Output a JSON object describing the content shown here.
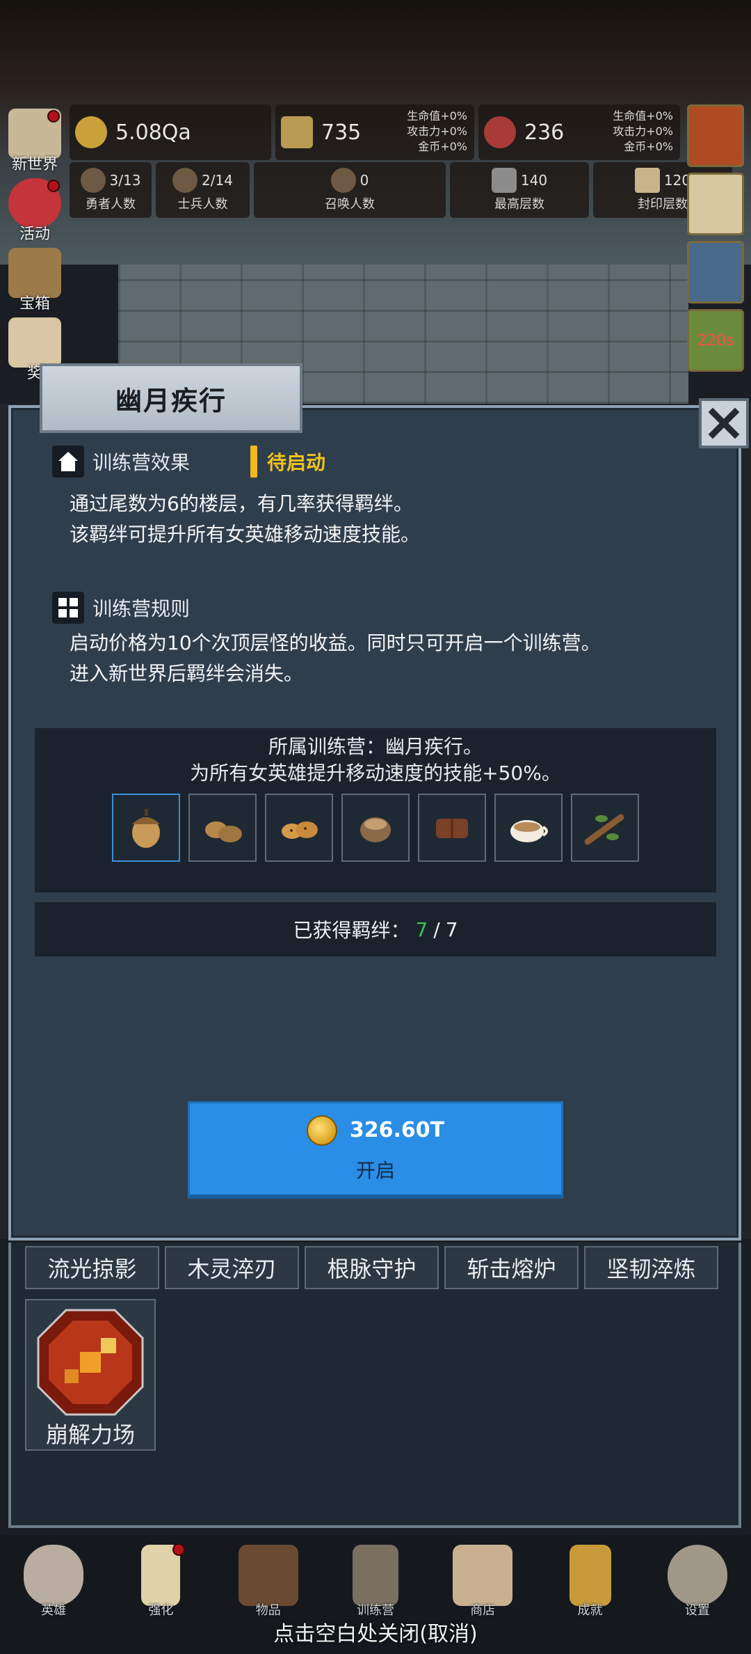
{
  "resources": {
    "gold": "5.08Qa",
    "wood": "735",
    "meat": "236",
    "bonus_a": [
      "生命值+0%",
      "攻击力+0%",
      "金币+0%"
    ],
    "bonus_b": [
      "生命值+0%",
      "攻击力+0%",
      "金币+0%"
    ]
  },
  "stats": [
    {
      "value": "3/13",
      "label": "勇者人数"
    },
    {
      "value": "2/14",
      "label": "士兵人数"
    },
    {
      "value": "0",
      "label": "召唤人数"
    },
    {
      "value": "140",
      "label": "最高层数"
    },
    {
      "value": "120",
      "label": "封印层数"
    }
  ],
  "side_nav": [
    "新世界",
    "活动",
    "宝箱",
    "奖"
  ],
  "right_timer": "220s",
  "modal": {
    "title": "幽月疾行",
    "effect_heading": "训练营效果",
    "status": "待启动",
    "effect_lines": [
      "通过尾数为6的楼层，有几率获得羁绊。",
      "该羁绊可提升所有女英雄移动速度技能。"
    ],
    "rules_heading": "训练营规则",
    "rules_lines": [
      "启动价格为10个次顶层怪的收益。同时只可开启一个训练营。",
      "进入新世界后羁绊会消失。"
    ],
    "bond_title_1": "所属训练营：幽月疾行。",
    "bond_title_2": "为所有女英雄提升移动速度的技能+50%。",
    "bond_items": [
      "acorn-icon",
      "potatoes-icon",
      "cookies-icon",
      "grain-sack-icon",
      "chocolate-icon",
      "coffee-cup-icon",
      "branch-icon"
    ],
    "gained_label": "已获得羁绊：",
    "gained_current": "7",
    "gained_total": "7",
    "cost": "326.60T",
    "start_label": "开启"
  },
  "skill_tags": [
    "流光掠影",
    "木灵淬刃",
    "根脉守护",
    "斩击熔炉",
    "坚韧淬炼"
  ],
  "skill_card": "崩解力场",
  "bottom_nav": [
    "英雄",
    "强化",
    "物品",
    "训练营",
    "商店",
    "成就",
    "设置"
  ],
  "close_hint": "点击空白处关闭(取消)",
  "colors": {
    "accent_blue": "#2a8de6",
    "status_yellow": "#f0c21e",
    "gained_green": "#3fbf58"
  }
}
